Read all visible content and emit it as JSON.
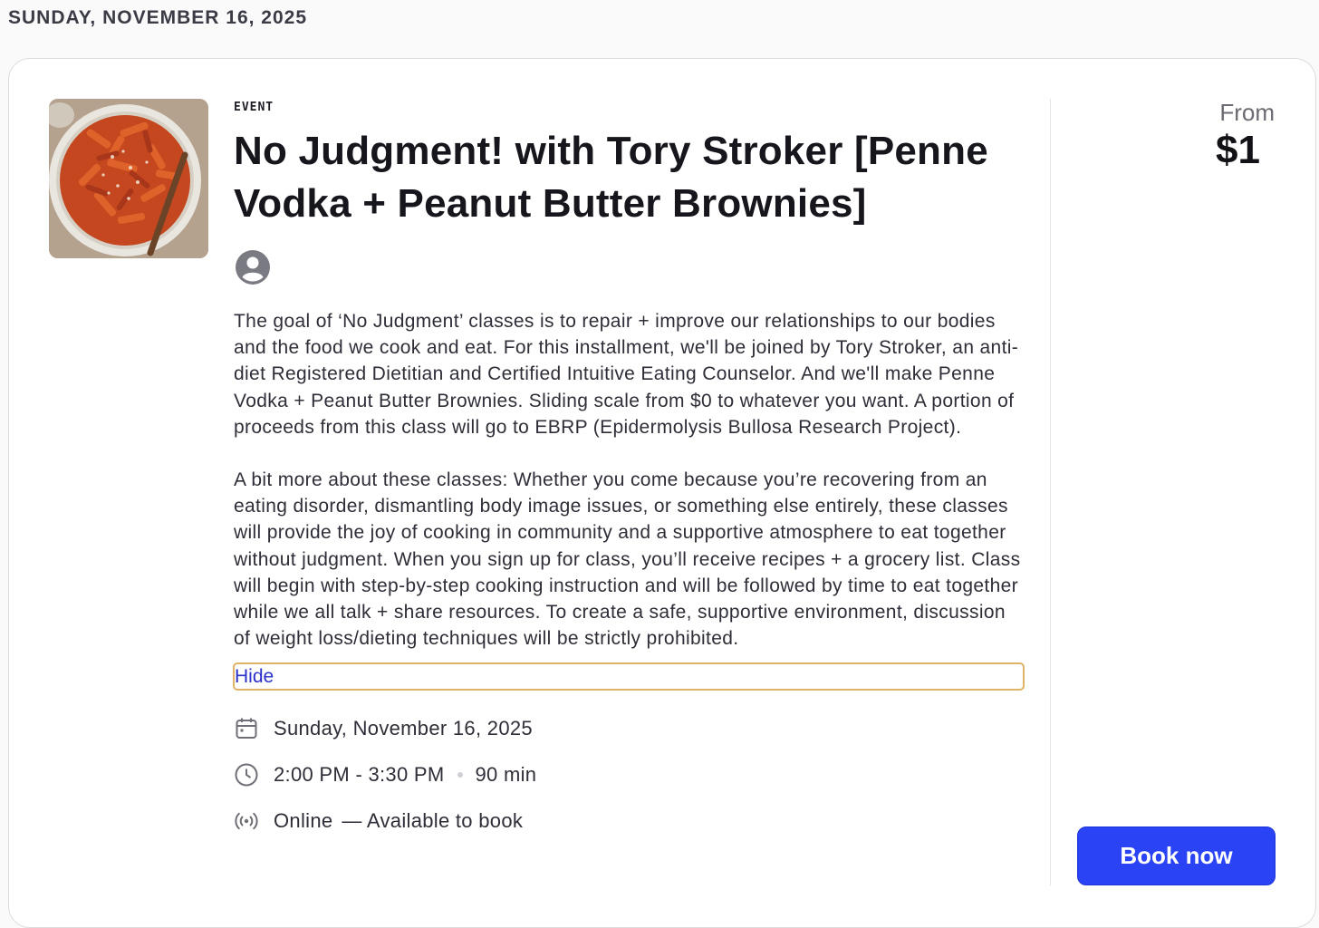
{
  "date_header": "SUNDAY, NOVEMBER 16, 2025",
  "event": {
    "eyebrow": "EVENT",
    "title": "No Judgment! with Tory Stroker [Penne Vodka + Peanut Butter Brownies]",
    "thumbnail_icon": "penne-vodka-dish-image",
    "host_icon": "user-avatar-icon",
    "description": [
      "The goal of ‘No Judgment’ classes is to repair + improve our relationships to our bodies and the food we cook and eat. For this installment, we'll be joined by Tory Stroker, an anti-diet Registered Dietitian and Certified Intuitive Eating Counselor. And we'll make Penne Vodka + Peanut Butter Brownies. Sliding scale from $0 to whatever you want. A portion of proceeds from this class will go to EBRP (Epidermolysis Bullosa Research Project).",
      "A bit more about these classes: Whether you come because you’re recovering from an eating disorder, dismantling body image issues, or something else entirely, these classes will provide the joy of cooking in community and a supportive atmosphere to eat together without judgment. When you sign up for class, you’ll receive recipes + a grocery list. Class will begin with step-by-step cooking instruction and will be followed by time to eat together while we all talk + share resources. To create a safe, supportive environment, discussion of weight loss/dieting techniques will be strictly prohibited."
    ],
    "hide_label": "Hide",
    "details": {
      "date": "Sunday, November 16, 2025",
      "time": "2:00 PM - 3:30 PM",
      "duration": "90 min",
      "location": "Online",
      "availability": "— Available to book"
    }
  },
  "pricing": {
    "from_label": "From",
    "price": "$1",
    "book_label": "Book now"
  },
  "colors": {
    "accent": "#2a43f5",
    "link": "#2b31c8",
    "focus_outline": "#e1b366"
  }
}
